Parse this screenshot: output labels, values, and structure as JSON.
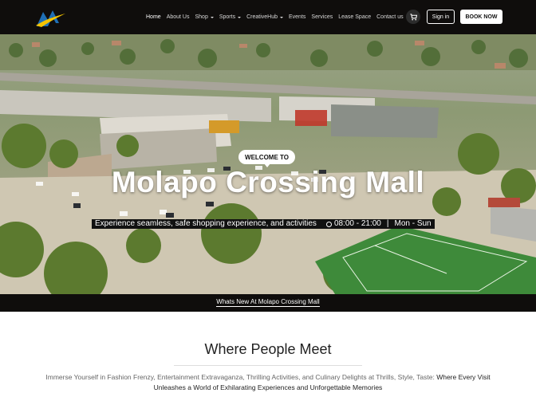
{
  "nav": {
    "items": [
      {
        "label": "Home",
        "active": true,
        "dropdown": false
      },
      {
        "label": "About Us",
        "active": false,
        "dropdown": false
      },
      {
        "label": "Shop",
        "active": false,
        "dropdown": true
      },
      {
        "label": "Sports",
        "active": false,
        "dropdown": true
      },
      {
        "label": "CreativeHub",
        "active": false,
        "dropdown": true
      },
      {
        "label": "Events",
        "active": false,
        "dropdown": false
      },
      {
        "label": "Services",
        "active": false,
        "dropdown": false
      },
      {
        "label": "Lease Space",
        "active": false,
        "dropdown": false
      },
      {
        "label": "Contact us",
        "active": false,
        "dropdown": false
      }
    ],
    "cart_icon": "cart-icon",
    "signin_label": "Sign in",
    "booknow_label": "BOOK NOW"
  },
  "hero": {
    "badge": "WELCOME TO",
    "title": "Molapo Crossing Mall",
    "tagline": "Experience seamless, safe shopping experience, and activities",
    "hours": "08:00 - 21:00",
    "days": "Mon - Sun",
    "slides": 7,
    "active_slide": 0
  },
  "news": {
    "label": "Whats New At Molapo Crossing Mall"
  },
  "intro": {
    "heading": "Where People Meet",
    "text_light": "Immerse Yourself in Fashion Frenzy, Entertainment Extravaganza, Thrilling Activities, and Culinary Delights at Thrills, Style, Taste:",
    "text_dark": "Where Every Visit Unleashes a World of Exhilarating Experiences and Unforgettable Memories"
  },
  "colors": {
    "nav_bg": "#0f0d0c",
    "logo_blue": "#1f6fb5",
    "logo_yellow": "#f5c400",
    "field_green": "#3e8a3a"
  }
}
